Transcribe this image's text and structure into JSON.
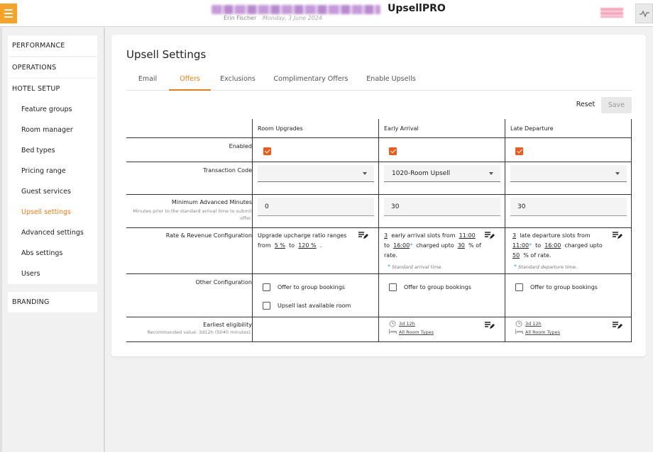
{
  "header": {
    "app_name": "UpsellPRO",
    "user_name": "Erin Fischer",
    "date": "Monday, 3 June 2024"
  },
  "sidebar": {
    "sections": [
      "PERFORMANCE",
      "OPERATIONS",
      "HOTEL SETUP",
      "BRANDING"
    ],
    "items": [
      {
        "label": "Feature groups"
      },
      {
        "label": "Room manager"
      },
      {
        "label": "Bed types"
      },
      {
        "label": "Pricing range"
      },
      {
        "label": "Guest services"
      },
      {
        "label": "Upsell settings",
        "active": true
      },
      {
        "label": "Advanced settings"
      },
      {
        "label": "Abs settings"
      },
      {
        "label": "Users"
      }
    ]
  },
  "page": {
    "title": "Upsell Settings",
    "tabs": [
      "Email",
      "Offers",
      "Exclusions",
      "Complimentary Offers",
      "Enable Upsells"
    ],
    "active_tab": "Offers",
    "reset_label": "Reset",
    "save_label": "Save"
  },
  "table": {
    "columns": [
      "Room Upgrades",
      "Early Arrival",
      "Late Departure"
    ],
    "rows": {
      "enabled": {
        "label": "Enabled",
        "values": [
          true,
          true,
          true
        ]
      },
      "transaction_code": {
        "label": "Transaction Code",
        "values": [
          "",
          "1020-Room Upsell",
          ""
        ]
      },
      "min_advanced": {
        "label": "Minimum Advanced Minutes",
        "sublabel": "Minutes prior to the standard arrival time to submit offer.",
        "values": [
          "0",
          "30",
          "30"
        ]
      },
      "rate_revenue": {
        "label": "Rate & Revenue Configuration",
        "room_upgrades": {
          "line1": "Upgrade upcharge ratio ranges",
          "from_word": "from",
          "from_value": "5 %",
          "to_word": "to",
          "to_value": "120 %",
          "end": "."
        },
        "early_arrival": {
          "slots": "3",
          "slots_text": "early arrival slots from",
          "from_time": "11:00",
          "to_word": "to",
          "to_time": "16:00",
          "charged_text": "charged upto",
          "percent": "30",
          "percent_text": "% of",
          "rate_text": "rate.",
          "hint": "Standard arrival time."
        },
        "late_departure": {
          "slots": "3",
          "slots_text": "late departure slots from",
          "from_time": "11:00",
          "to_word": "to",
          "to_time": "16:00",
          "charged_text": "charged upto",
          "percent": "50",
          "percent_text": "% of rate.",
          "hint": "Standard departure time."
        }
      },
      "other_config": {
        "label": "Other Configuration",
        "room_upgrades": [
          {
            "label": "Offer to group bookings",
            "checked": false
          },
          {
            "label": "Upsell last available room",
            "checked": false
          }
        ],
        "early_arrival": [
          {
            "label": "Offer to group bookings",
            "checked": false
          }
        ],
        "late_departure": [
          {
            "label": "Offer to group bookings",
            "checked": false
          }
        ]
      },
      "earliest_eligibility": {
        "label": "Earliest eligibility",
        "sublabel": "Recommended value: 3d12h (5040 minutes).",
        "early_arrival": {
          "duration": "3d 12h",
          "room_types": "All Room Types"
        },
        "late_departure": {
          "duration": "3d 12h",
          "room_types": "All Room Types"
        }
      }
    }
  },
  "colors": {
    "accent": "#ef7d12",
    "checkbox": "#f0591a",
    "menu": "#f7a328"
  },
  "icons": [
    "menu-icon",
    "pulse-icon",
    "dropdown-caret-icon",
    "edit-list-icon",
    "clock-icon",
    "bed-icon"
  ]
}
